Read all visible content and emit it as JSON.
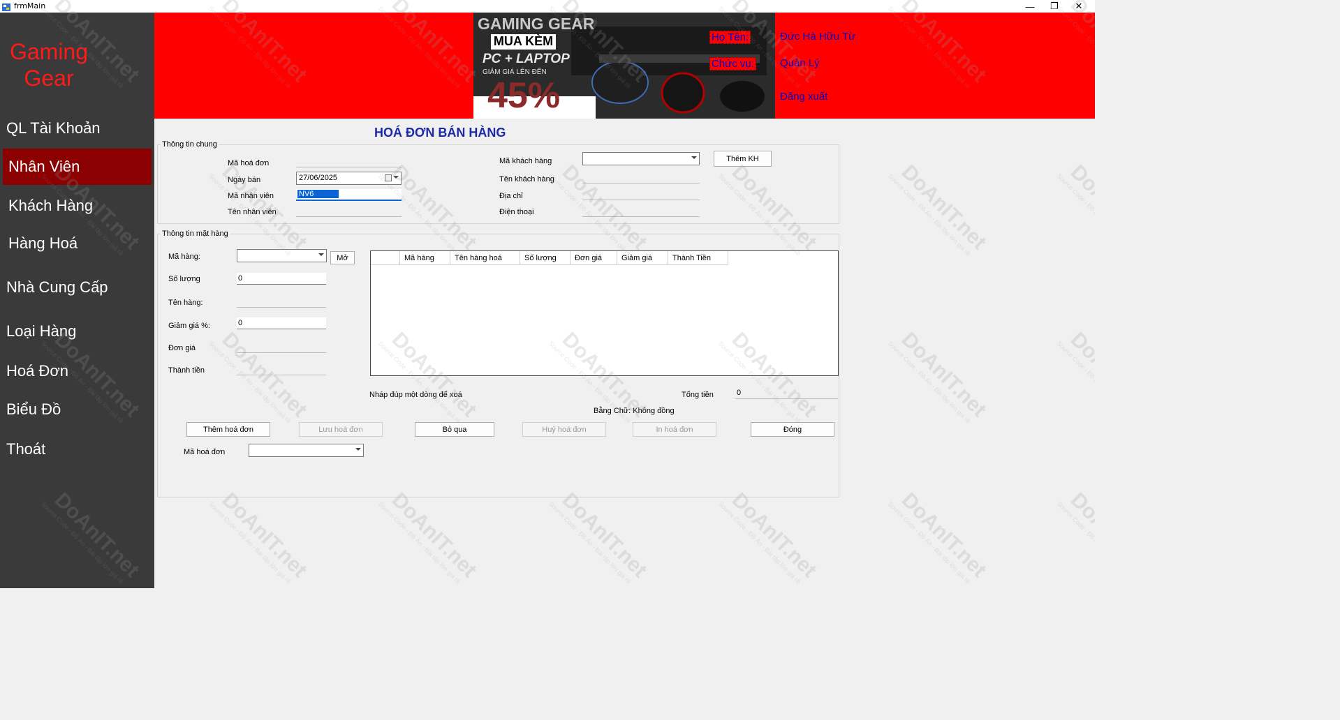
{
  "window": {
    "title": "frmMain",
    "minimize_glyph": "—",
    "maximize_glyph": "❐",
    "close_glyph": "✕"
  },
  "sidebar": {
    "brand_line1": "Gaming",
    "brand_line2": "Gear",
    "items": [
      {
        "label": "QL Tài Khoản"
      },
      {
        "label": "Nhân Viên"
      },
      {
        "label": "Khách Hàng"
      },
      {
        "label": "Hàng Hoá"
      },
      {
        "label": "Nhà Cung Cấp"
      },
      {
        "label": "Loại Hàng"
      },
      {
        "label": "Hoá Đơn"
      },
      {
        "label": "Biểu Đồ"
      },
      {
        "label": "Thoát"
      }
    ],
    "active_index": 1
  },
  "header": {
    "banner": {
      "line1": "GAMING GEAR",
      "line2": "MUA KÈM",
      "line3": "PC + LAPTOP",
      "line4": "GIẢM GIÁ LÊN ĐẾN",
      "line5": "45%"
    },
    "name_label": "Họ Tên:",
    "name_value": "Đức Hà Hữu Từ",
    "role_label": "Chức vụ:",
    "role_value": "Quản Lý",
    "logout": "Đăng xuất"
  },
  "page": {
    "title": "HOÁ ĐƠN BÁN HÀNG"
  },
  "general": {
    "caption": "Thông tin chung",
    "invoice_id_label": "Mã hoá đơn",
    "invoice_id_value": "",
    "sale_date_label": "Ngày bán",
    "sale_date_value": "27/06/2025",
    "employee_id_label": "Mã nhân viên",
    "employee_id_value": "NV6",
    "employee_name_label": "Tên nhân viên",
    "employee_name_value": "",
    "customer_id_label": "Mã khách hàng",
    "customer_id_value": "",
    "add_customer_button": "Thêm KH",
    "customer_name_label": "Tên khách hàng",
    "address_label": "Địa chỉ",
    "phone_label": "Điện thoại"
  },
  "items": {
    "caption": "Thông tin mặt hàng",
    "product_id_label": "Mã hàng:",
    "open_button": "Mở",
    "quantity_label": "Số lượng",
    "quantity_value": "0",
    "product_name_label": "Tên hàng:",
    "discount_label": "Giảm giá %:",
    "discount_value": "0",
    "unit_price_label": "Đơn giá",
    "subtotal_label": "Thành tiền",
    "grid_columns": [
      "Mã hàng",
      "Tên hàng hoá",
      "Số lượng",
      "Đơn giá",
      "Giảm giá",
      "Thành Tiền"
    ]
  },
  "totals": {
    "hint": "Nháp đúp một dòng để xoá",
    "total_label": "Tổng tiền",
    "total_value": "0",
    "in_words": "Bằng Chữ: Không đồng"
  },
  "actions": {
    "add_invoice": "Thêm hoá đơn",
    "save_invoice": "Lưu hoá đơn",
    "skip": "Bỏ qua",
    "cancel_invoice": "Huỷ hoá đơn",
    "print_invoice": "In hoá đơn",
    "close": "Đóng"
  },
  "search": {
    "invoice_id_label": "Mã hoá đơn",
    "invoice_id_value": ""
  },
  "watermark": {
    "text": "DoAnIT.net",
    "subtext": "Source Code - Đồ Án - Bài tập lớn giá rẻ"
  },
  "colors": {
    "sidebar": "#3a3a3a",
    "active_item": "#8b0000",
    "header": "#ff0000",
    "brand": "#ff1a1a",
    "title": "#1d2aa8",
    "header_text": "#0000cc"
  }
}
